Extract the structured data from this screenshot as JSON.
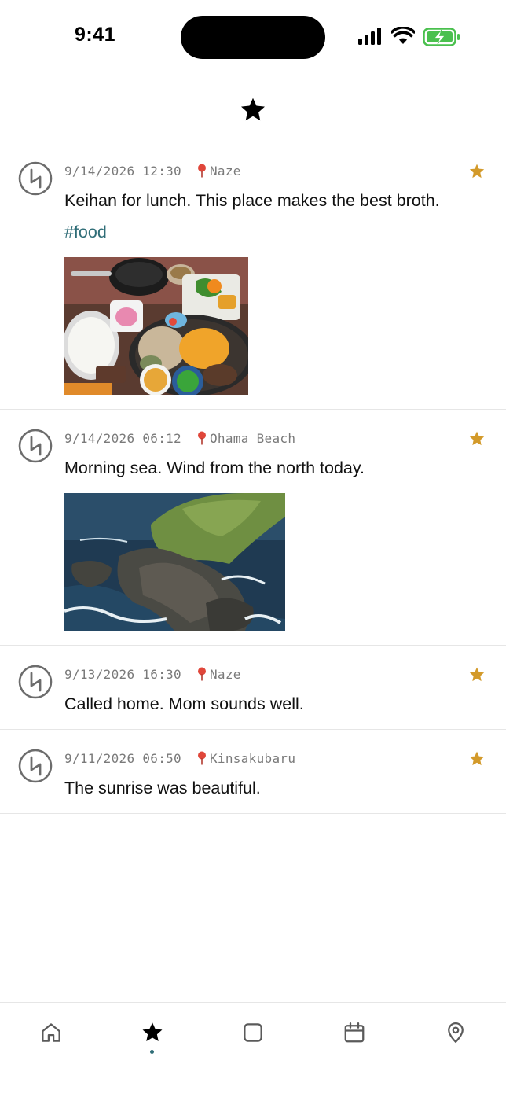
{
  "status_bar": {
    "time": "9:41"
  },
  "header": {
    "icon": "star-icon"
  },
  "colors": {
    "accent": "#2f6d77",
    "star": "#d39a2a",
    "meta": "#7a7a7a"
  },
  "entries": [
    {
      "date": "9/14/2026 12:30",
      "location": "Naze",
      "text": "Keihan for lunch. This place makes the best broth.",
      "tag": "#food",
      "photo": "food-photo",
      "starred": true
    },
    {
      "date": "9/14/2026 06:12",
      "location": "Ohama Beach",
      "text": "Morning sea. Wind from the north today.",
      "photo": "coast-photo",
      "starred": true
    },
    {
      "date": "9/13/2026 16:30",
      "location": "Naze",
      "text": "Called home. Mom sounds well.",
      "starred": true
    },
    {
      "date": "9/11/2026 06:50",
      "location": "Kinsakubaru",
      "text": "The sunrise was beautiful.",
      "starred": true
    }
  ],
  "tabbar": {
    "tabs": [
      "home-icon",
      "star-icon",
      "square-icon",
      "calendar-icon",
      "location-pin-icon"
    ],
    "selected": "star-icon"
  }
}
